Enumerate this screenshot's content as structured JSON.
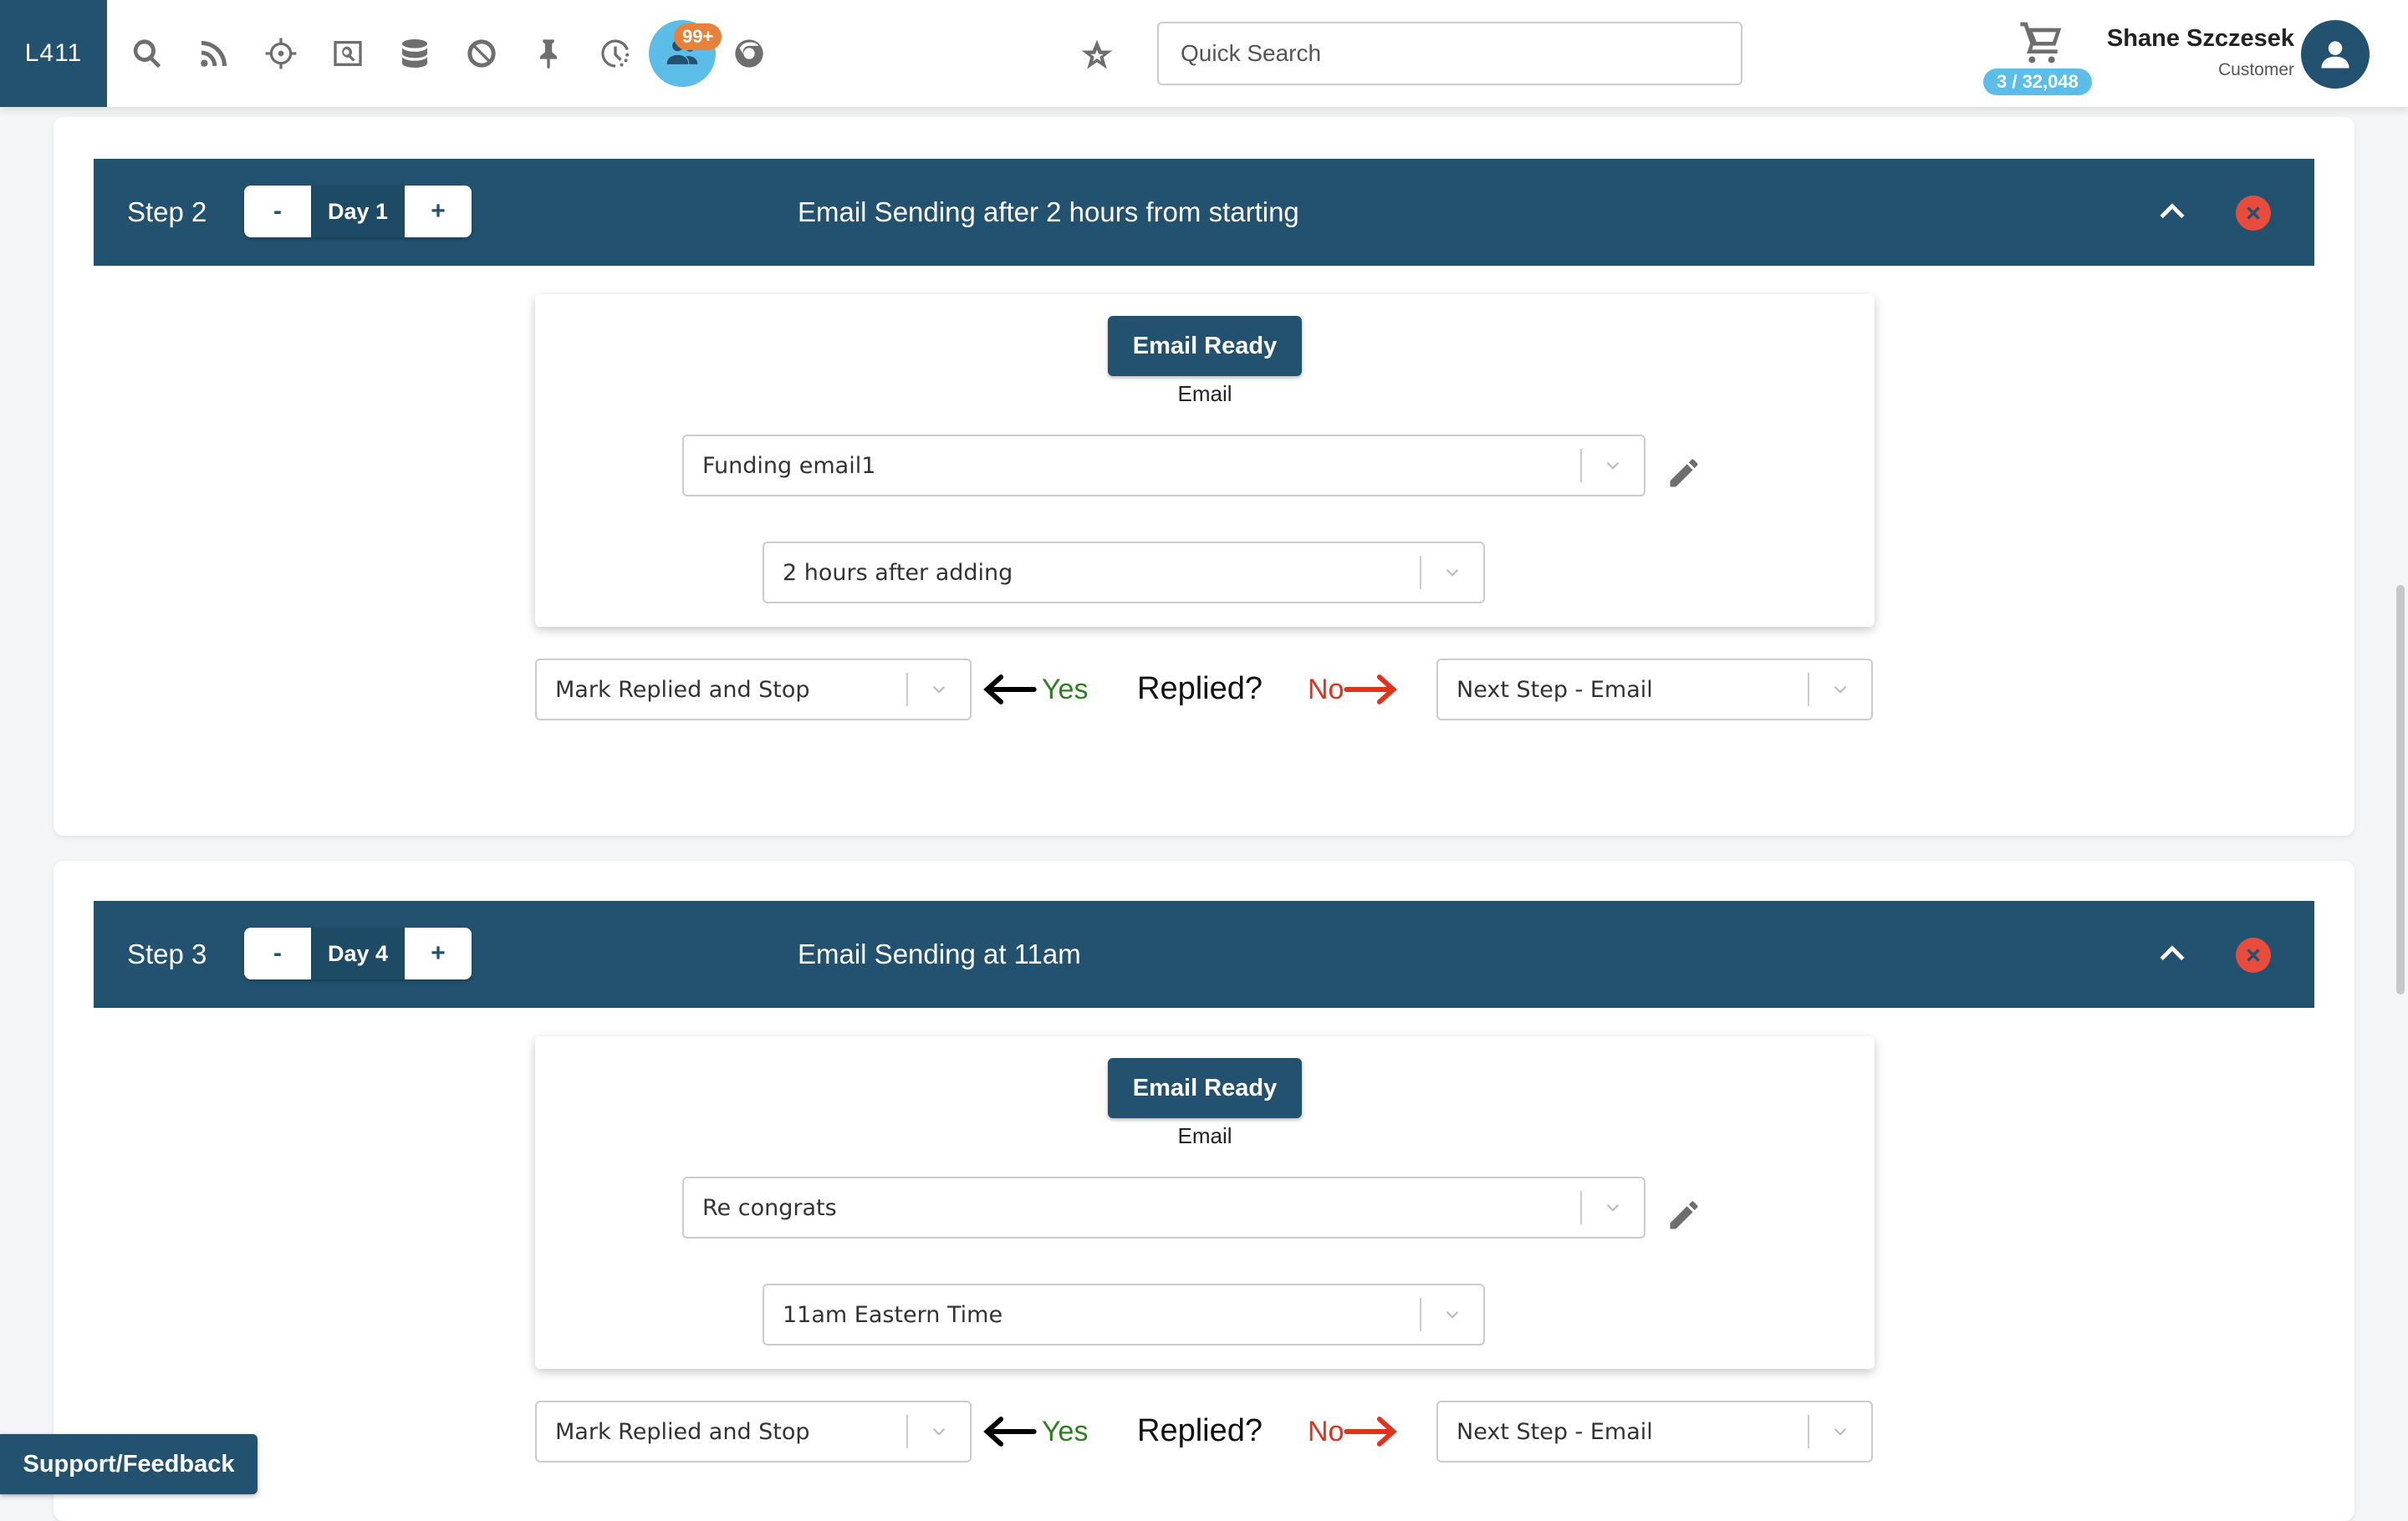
{
  "topbar": {
    "logo": "L411",
    "icons": [
      "search-icon",
      "rss-icon",
      "crosshair-icon",
      "screen-search-icon",
      "database-icon",
      "block-icon",
      "pin-icon",
      "history-icon",
      "team-icon",
      "chrome-icon"
    ],
    "team_badge": "99+",
    "search_placeholder": "Quick Search",
    "cart_count": "3 / 32,048",
    "user_name": "Shane Szczesek",
    "user_role": "Customer"
  },
  "steps": [
    {
      "label": "Step 2",
      "day": "Day 1",
      "minus": "-",
      "plus": "+",
      "title": "Email Sending after 2 hours from starting",
      "ready_label": "Email Ready",
      "ready_sub": "Email",
      "template": "Funding email1",
      "timing": "2 hours after adding",
      "yes_action": "Mark Replied and Stop",
      "yes_label": "Yes",
      "question": "Replied?",
      "no_label": "No",
      "no_action": "Next Step - Email"
    },
    {
      "label": "Step 3",
      "day": "Day 4",
      "minus": "-",
      "plus": "+",
      "title": "Email Sending at 11am",
      "ready_label": "Email Ready",
      "ready_sub": "Email",
      "template": "Re congrats",
      "timing": "11am Eastern Time",
      "yes_action": "Mark Replied and Stop",
      "yes_label": "Yes",
      "question": "Replied?",
      "no_label": "No",
      "no_action": "Next Step - Email"
    }
  ],
  "support_label": "Support/Feedback",
  "colors": {
    "brand": "#22526f",
    "accent": "#5bbde8",
    "badge": "#e8823a",
    "danger": "#e74c3c",
    "yes": "#2e7d1e",
    "no": "#e0321c"
  }
}
